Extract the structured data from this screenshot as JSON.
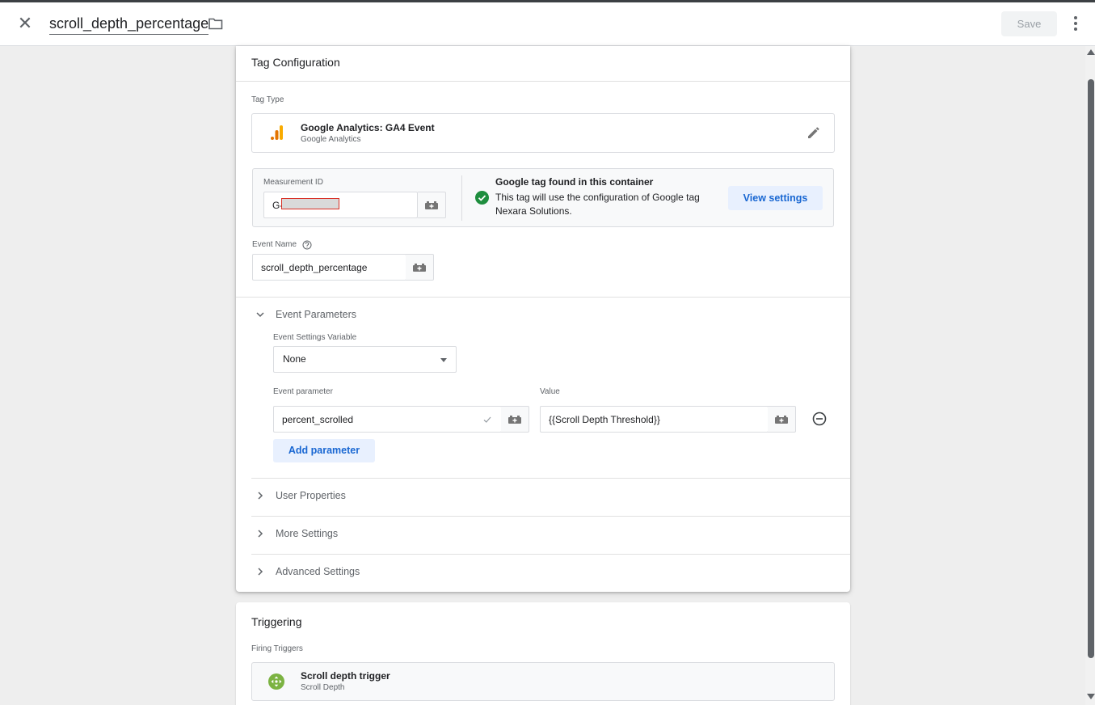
{
  "header": {
    "close_icon": "close-icon",
    "title": "scroll_depth_percentage",
    "folder_icon": "folder-icon",
    "save_label": "Save",
    "more_icon": "more-vert-icon"
  },
  "tag_config": {
    "title": "Tag Configuration",
    "tag_type_label": "Tag Type",
    "tag_type": {
      "name": "Google Analytics: GA4 Event",
      "provider": "Google Analytics",
      "icon": "analytics-icon",
      "edit_icon": "pencil-icon"
    },
    "measurement": {
      "label": "Measurement ID",
      "value": "G-",
      "status_title": "Google tag found in this container",
      "status_text": "This tag will use the configuration of Google tag Nexara Solutions.",
      "view_settings_label": "View settings"
    },
    "event_name": {
      "label": "Event Name",
      "value": "scroll_depth_percentage"
    },
    "event_parameters": {
      "title": "Event Parameters",
      "settings_variable_label": "Event Settings Variable",
      "settings_variable_value": "None",
      "param_col_label": "Event parameter",
      "value_col_label": "Value",
      "rows": [
        {
          "parameter": "percent_scrolled",
          "value": "{{Scroll Depth Threshold}}"
        }
      ],
      "add_label": "Add parameter"
    },
    "collapsed_sections": [
      "User Properties",
      "More Settings",
      "Advanced Settings"
    ]
  },
  "triggering": {
    "title": "Triggering",
    "firing_label": "Firing Triggers",
    "trigger": {
      "name": "Scroll depth trigger",
      "type": "Scroll Depth",
      "icon": "scroll-trigger-icon"
    }
  },
  "colors": {
    "accent": "#1967d2",
    "success": "#1e8e3e",
    "trigger_green": "#7cb342",
    "analytics_orange": "#f9ab00"
  }
}
